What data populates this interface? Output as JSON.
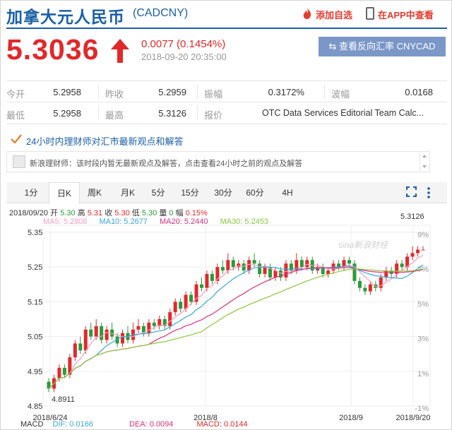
{
  "header": {
    "title": "加拿大元人民币",
    "code": "(CADCNY)",
    "watch_label": "添加自选",
    "app_label": "在APP中查看"
  },
  "quote": {
    "price": "5.3036",
    "change": "0.0077 (0.1454%)",
    "datetime": "2018-09-20 20:35:00",
    "reverse_button": "⇆ 查看反向汇率 CNYCAD"
  },
  "stats": [
    [
      {
        "label": "今开",
        "value": "5.2958"
      },
      {
        "label": "昨收",
        "value": "5.2959"
      },
      {
        "label": "振幅",
        "value": "0.3172%"
      },
      {
        "label": "波幅",
        "value": "0.0168"
      }
    ],
    [
      {
        "label": "最低",
        "value": "5.2958"
      },
      {
        "label": "最高",
        "value": "5.3126"
      },
      {
        "label": "报价",
        "value": "OTC Data Services Editorial Team Calc..."
      }
    ]
  ],
  "expert": {
    "title": "24小时内理财师对汇市最新观点和解答",
    "notice": "新浪理财师：该时段内暂无最新观点及解答，点击查看24小时之前的观点及解答"
  },
  "tabs": [
    "1分",
    "日K",
    "周K",
    "月K",
    "5分",
    "15分",
    "30分",
    "60分",
    "4H"
  ],
  "active_tab": "日K",
  "ohlc": {
    "date": "2018/09/20",
    "open_label": "开",
    "open": "5.30",
    "high_label": "高",
    "high": "5.31",
    "close_label": "收",
    "close": "5.30",
    "low_label": "低",
    "low": "5.30",
    "vol_label": "量",
    "vol": "0",
    "amp_label": "幅",
    "amp": "0.15%"
  },
  "ma": [
    {
      "label": "MA5: 5.2808",
      "color": "#f29dc3"
    },
    {
      "label": "MA10: 5.2677",
      "color": "#3aa6d6"
    },
    {
      "label": "MA20: 5.2440",
      "color": "#e0307a"
    },
    {
      "label": "MA30: 5.2453",
      "color": "#8cc63f"
    }
  ],
  "macd": {
    "title": "MACD",
    "dif": "DIF: 0.0166",
    "dif_color": "#3aa6d6",
    "dea": "DEA: 0.0094",
    "dea_color": "#e0307a",
    "macd": "MACD: 0.0144",
    "macd_color": "#e0292b"
  },
  "watermark": "sina新浪财经",
  "chart_data": {
    "type": "candlestick",
    "y_ticks": [
      "5.35",
      "5.25",
      "5.15",
      "5.05",
      "4.95",
      "4.85"
    ],
    "pct_ticks": [
      "9%",
      "7%",
      "5%",
      "3%",
      "1%",
      "-1%"
    ],
    "x_ticks": [
      "2018/6/24",
      "2018/8",
      "2018/9",
      "2018/9/20"
    ],
    "ylim": [
      4.85,
      5.35
    ],
    "high_label": "5.3126",
    "low_label": "4.8911",
    "candles": [
      [
        4.92,
        4.9,
        4.93,
        4.89
      ],
      [
        4.9,
        4.93,
        4.94,
        4.89
      ],
      [
        4.93,
        4.96,
        4.97,
        4.92
      ],
      [
        4.96,
        4.94,
        4.97,
        4.93
      ],
      [
        4.94,
        4.99,
        5.0,
        4.93
      ],
      [
        4.99,
        5.03,
        5.04,
        4.98
      ],
      [
        5.03,
        5.01,
        5.05,
        5.0
      ],
      [
        5.01,
        5.07,
        5.08,
        5.0
      ],
      [
        5.07,
        5.05,
        5.09,
        5.04
      ],
      [
        5.05,
        5.08,
        5.1,
        5.04
      ],
      [
        5.08,
        5.04,
        5.09,
        5.03
      ],
      [
        5.04,
        5.07,
        5.08,
        5.03
      ],
      [
        5.07,
        5.05,
        5.09,
        5.04
      ],
      [
        5.05,
        5.03,
        5.06,
        5.02
      ],
      [
        5.03,
        5.06,
        5.07,
        5.02
      ],
      [
        5.06,
        5.04,
        5.08,
        5.03
      ],
      [
        5.04,
        5.07,
        5.09,
        5.03
      ],
      [
        5.07,
        5.08,
        5.1,
        5.06
      ],
      [
        5.08,
        5.06,
        5.09,
        5.05
      ],
      [
        5.06,
        5.09,
        5.1,
        5.05
      ],
      [
        5.09,
        5.08,
        5.1,
        5.07
      ],
      [
        5.08,
        5.1,
        5.11,
        5.07
      ],
      [
        5.1,
        5.08,
        5.11,
        5.07
      ],
      [
        5.08,
        5.12,
        5.13,
        5.07
      ],
      [
        5.12,
        5.15,
        5.16,
        5.11
      ],
      [
        5.15,
        5.13,
        5.16,
        5.12
      ],
      [
        5.13,
        5.17,
        5.18,
        5.12
      ],
      [
        5.17,
        5.15,
        5.18,
        5.14
      ],
      [
        5.15,
        5.2,
        5.21,
        5.14
      ],
      [
        5.2,
        5.19,
        5.22,
        5.18
      ],
      [
        5.19,
        5.23,
        5.24,
        5.18
      ],
      [
        5.23,
        5.21,
        5.24,
        5.2
      ],
      [
        5.21,
        5.25,
        5.26,
        5.2
      ],
      [
        5.25,
        5.24,
        5.27,
        5.23
      ],
      [
        5.24,
        5.27,
        5.29,
        5.23
      ],
      [
        5.27,
        5.25,
        5.28,
        5.24
      ],
      [
        5.25,
        5.26,
        5.27,
        5.24
      ],
      [
        5.26,
        5.24,
        5.27,
        5.23
      ],
      [
        5.24,
        5.27,
        5.28,
        5.23
      ],
      [
        5.27,
        5.26,
        5.29,
        5.25
      ],
      [
        5.26,
        5.23,
        5.27,
        5.22
      ],
      [
        5.23,
        5.25,
        5.26,
        5.22
      ],
      [
        5.25,
        5.22,
        5.26,
        5.21
      ],
      [
        5.22,
        5.24,
        5.25,
        5.21
      ],
      [
        5.24,
        5.22,
        5.25,
        5.21
      ],
      [
        5.22,
        5.26,
        5.27,
        5.21
      ],
      [
        5.26,
        5.24,
        5.27,
        5.23
      ],
      [
        5.24,
        5.27,
        5.29,
        5.23
      ],
      [
        5.27,
        5.25,
        5.28,
        5.24
      ],
      [
        5.25,
        5.27,
        5.28,
        5.24
      ],
      [
        5.27,
        5.24,
        5.28,
        5.23
      ],
      [
        5.24,
        5.25,
        5.26,
        5.23
      ],
      [
        5.25,
        5.23,
        5.26,
        5.22
      ],
      [
        5.23,
        5.24,
        5.25,
        5.22
      ],
      [
        5.24,
        5.26,
        5.27,
        5.23
      ],
      [
        5.26,
        5.25,
        5.27,
        5.24
      ],
      [
        5.25,
        5.27,
        5.28,
        5.24
      ],
      [
        5.27,
        5.26,
        5.28,
        5.25
      ],
      [
        5.26,
        5.21,
        5.27,
        5.2
      ],
      [
        5.21,
        5.19,
        5.22,
        5.18
      ],
      [
        5.19,
        5.18,
        5.2,
        5.17
      ],
      [
        5.18,
        5.2,
        5.21,
        5.17
      ],
      [
        5.2,
        5.19,
        5.21,
        5.18
      ],
      [
        5.19,
        5.22,
        5.23,
        5.18
      ],
      [
        5.22,
        5.24,
        5.25,
        5.21
      ],
      [
        5.24,
        5.23,
        5.25,
        5.22
      ],
      [
        5.23,
        5.26,
        5.27,
        5.22
      ],
      [
        5.26,
        5.25,
        5.27,
        5.24
      ],
      [
        5.25,
        5.28,
        5.29,
        5.24
      ],
      [
        5.28,
        5.29,
        5.31,
        5.27
      ],
      [
        5.29,
        5.3,
        5.31,
        5.28
      ],
      [
        5.3,
        5.3,
        5.31,
        5.3
      ]
    ]
  }
}
